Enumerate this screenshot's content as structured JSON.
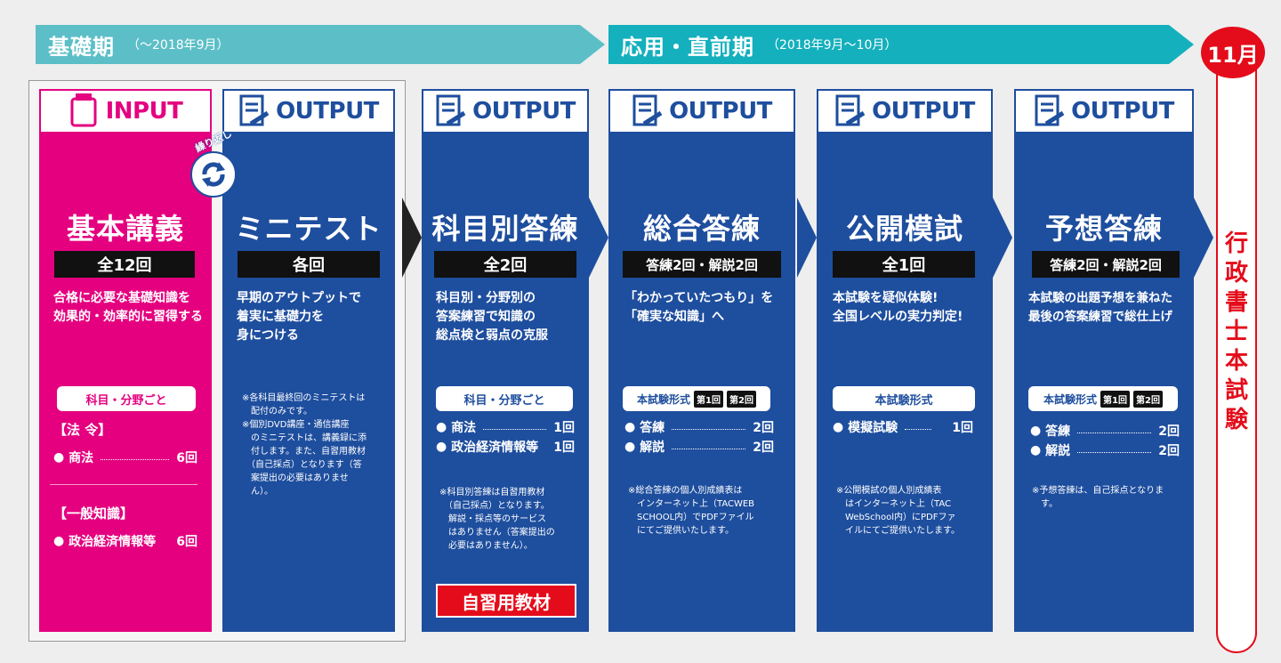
{
  "phases": {
    "basic": {
      "label": "基礎期",
      "period": "（〜2018年9月）"
    },
    "applied": {
      "label": "応用・直前期",
      "period": "（2018年9月〜10月）"
    }
  },
  "exam": {
    "month": "11月",
    "label": "行政書士本試験"
  },
  "repeat_label": "繰り返し",
  "columns": [
    {
      "header": "INPUT",
      "title": "基本講義",
      "count": "全12回",
      "desc": [
        "合格に必要な基礎知識を",
        "効果的・効率的に習得する"
      ],
      "pill": "科目・分野ごと",
      "section1": "【法 令】",
      "items1": [
        {
          "name": "商法",
          "value": "6回"
        }
      ],
      "section2": "【一般知識】",
      "items2": [
        {
          "name": "政治経済情報等",
          "value": "6回"
        }
      ]
    },
    {
      "header": "OUTPUT",
      "title": "ミニテスト",
      "count": "各回",
      "desc": [
        "早期のアウトプットで",
        "着実に基礎力を",
        "身につける"
      ],
      "notes": [
        "※各科目最終回のミニテストは",
        "　配付のみです。",
        "※個別DVD講座・通信講座",
        "　のミニテストは、講義録に添",
        "　付します。また、自習用教材",
        "　（自己採点）となります（答",
        "　案提出の必要はありませ",
        "　ん）。"
      ]
    },
    {
      "header": "OUTPUT",
      "title": "科目別答練",
      "count": "全2回",
      "desc": [
        "科目別・分野別の",
        "答案練習で知識の",
        "総点検と弱点の克服"
      ],
      "pill": "科目・分野ごと",
      "items": [
        {
          "name": "商法",
          "value": "1回"
        },
        {
          "name": "政治経済情報等",
          "value": "1回"
        }
      ],
      "notes": [
        "※科目別答練は自習用教材",
        "　（自己採点）となります。",
        "　解説・採点等のサービス",
        "　はありません（答案提出の",
        "　必要はありません）。"
      ],
      "badge": "自習用教材"
    },
    {
      "header": "OUTPUT",
      "title": "総合答練",
      "count": "答練2回・解説2回",
      "desc": [
        "「わかっていたつもり」を",
        "「確実な知識」へ"
      ],
      "pill": "本試験形式",
      "tags": [
        "第1回",
        "第2回"
      ],
      "items": [
        {
          "name": "答練",
          "value": "2回"
        },
        {
          "name": "解説",
          "value": "2回"
        }
      ],
      "notes": [
        "※総合答練の個人別成績表は",
        "　インターネット上（TACWEB",
        "　SCHOOL内）でPDFファイル",
        "　にてご提供いたします。"
      ]
    },
    {
      "header": "OUTPUT",
      "title": "公開模試",
      "count": "全1回",
      "desc": [
        "本試験を疑似体験!",
        "全国レベルの実力判定!"
      ],
      "pill": "本試験形式",
      "items": [
        {
          "name": "模擬試験",
          "value": "1回"
        }
      ],
      "notes": [
        "※公開模試の個人別成績表",
        "　はインターネット上（TAC",
        "　WebSchool内）にPDFファ",
        "　イルにてご提供いたします。"
      ]
    },
    {
      "header": "OUTPUT",
      "title": "予想答練",
      "count": "答練2回・解説2回",
      "desc": [
        "本試験の出題予想を兼ねた",
        "最後の答案練習で総仕上げ"
      ],
      "pill": "本試験形式",
      "tags": [
        "第1回",
        "第2回"
      ],
      "items": [
        {
          "name": "答練",
          "value": "2回"
        },
        {
          "name": "解説",
          "value": "2回"
        }
      ],
      "notes": [
        "※予想答練は、自己採点となりま",
        "　す。"
      ]
    }
  ],
  "colors": {
    "pink": "#e4007f",
    "blue": "#1e4e9e",
    "teal_light": "#5cbfc7",
    "teal": "#14b0bd",
    "red": "#e40c1a"
  }
}
